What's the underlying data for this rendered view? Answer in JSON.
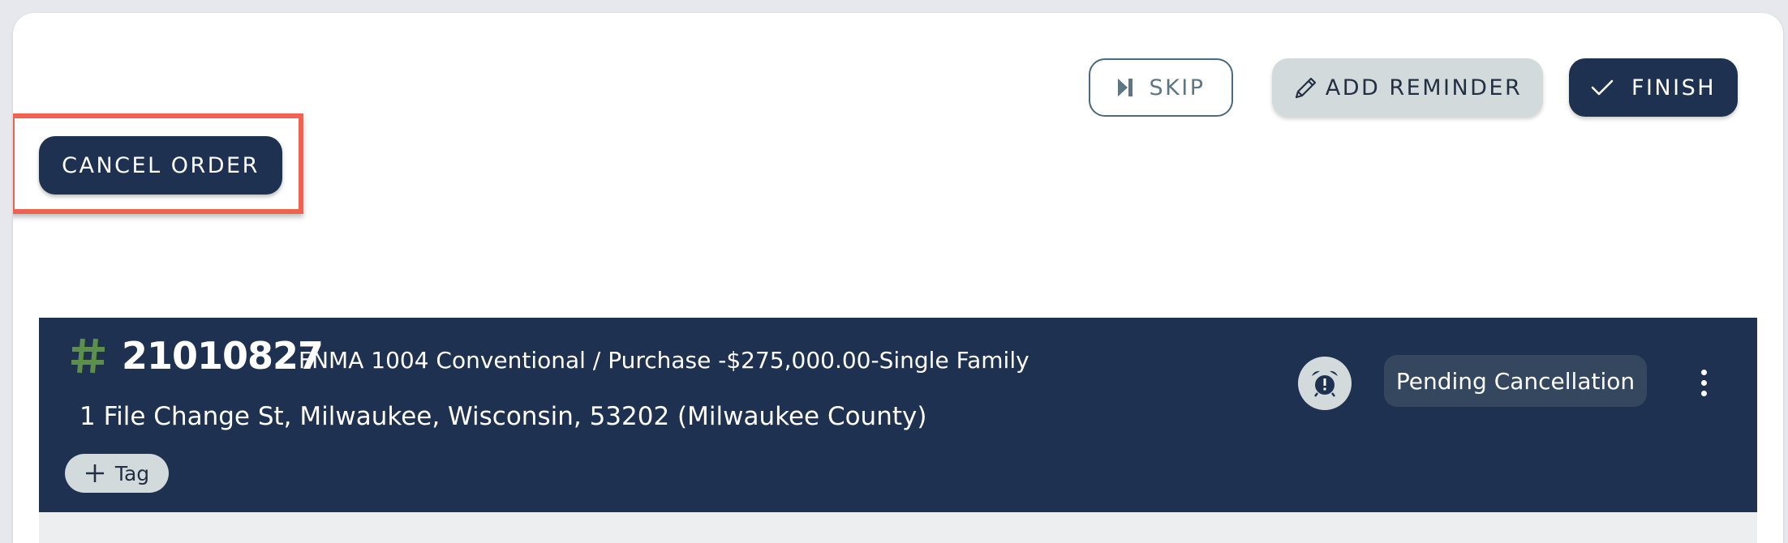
{
  "toolbar": {
    "skip_label": "SKIP",
    "skip_icon": "skip-next-icon",
    "add_reminder_label": "ADD REMINDER",
    "add_reminder_icon": "pencil-icon",
    "finish_label": "FINISH",
    "finish_icon": "check-icon"
  },
  "cancel_order_label": "CANCEL ORDER",
  "order": {
    "number": "21010827",
    "description": "FNMA 1004 Conventional / Purchase -$275,000.00-Single Family",
    "address": "1 File Change St, Milwaukee, Wisconsin, 53202 (Milwaukee County)",
    "tag_label": "Tag",
    "tag_icon": "plus-icon",
    "alarm_icon": "alarm-clock-icon",
    "status": "Pending Cancellation",
    "more_icon": "more-vertical-icon"
  },
  "colors": {
    "navy": "#1e3150",
    "highlight": "#f0614f",
    "hash_green": "#5c8f4c",
    "light_button": "#d3dadc"
  }
}
